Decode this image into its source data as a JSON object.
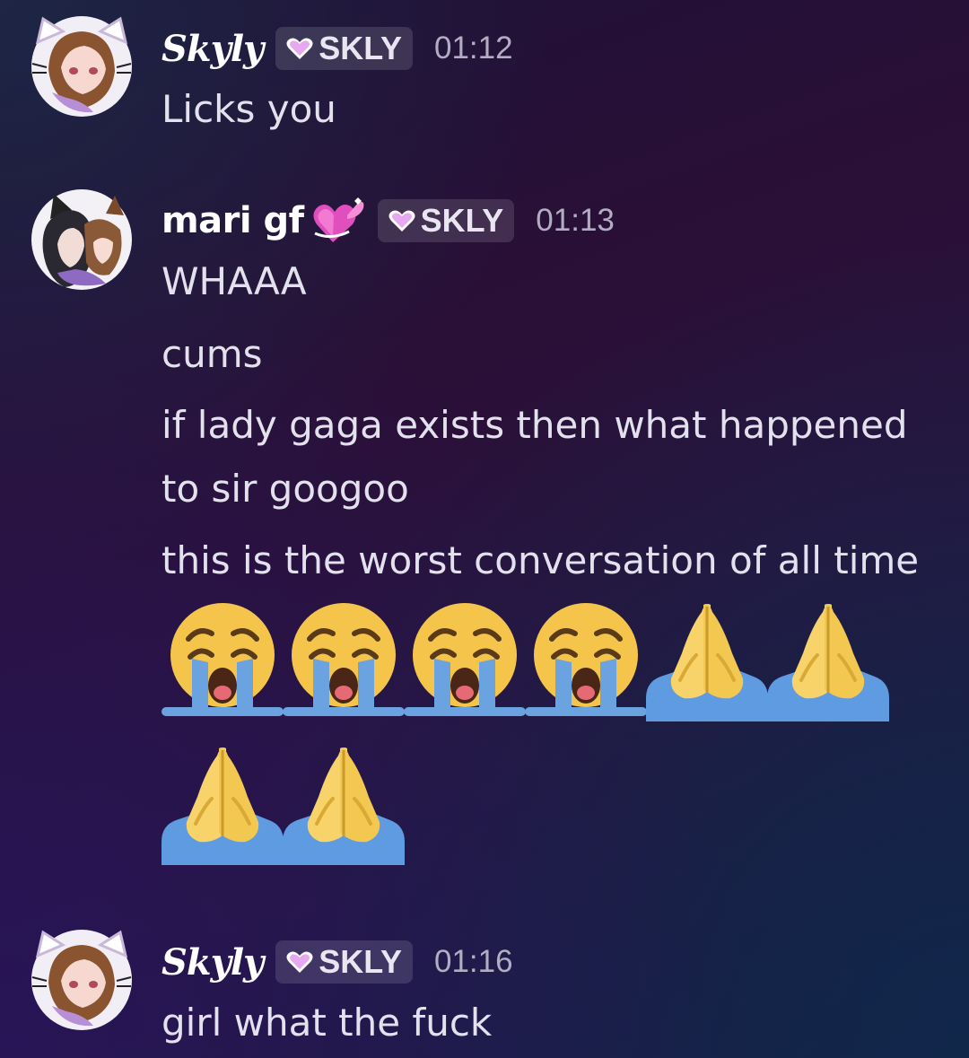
{
  "messages": [
    {
      "username": "Skyly",
      "tag": "SKLY",
      "time": "01:12",
      "lines": [
        "Licks you"
      ]
    },
    {
      "username": "mari gf",
      "name_emoji": "heart-with-ribbon-emoji",
      "tag": "SKLY",
      "time": "01:13",
      "lines": [
        "WHAAA",
        "cums",
        "if lady gaga exists then what happened",
        "to sir googoo",
        "this is the worst conversation of all time"
      ],
      "emojis_row1": [
        "loudly-crying-face",
        "loudly-crying-face",
        "loudly-crying-face",
        "loudly-crying-face",
        "folded-hands",
        "folded-hands"
      ],
      "emojis_row2": [
        "folded-hands",
        "folded-hands"
      ]
    },
    {
      "username": "Skyly",
      "tag": "SKLY",
      "time": "01:16",
      "lines": [
        "girl what the fuck"
      ]
    }
  ],
  "colors": {
    "tag_heart": "#e7a8f2",
    "tag_bg": "rgba(255,255,255,0.13)",
    "timestamp": "#b3adc4"
  }
}
